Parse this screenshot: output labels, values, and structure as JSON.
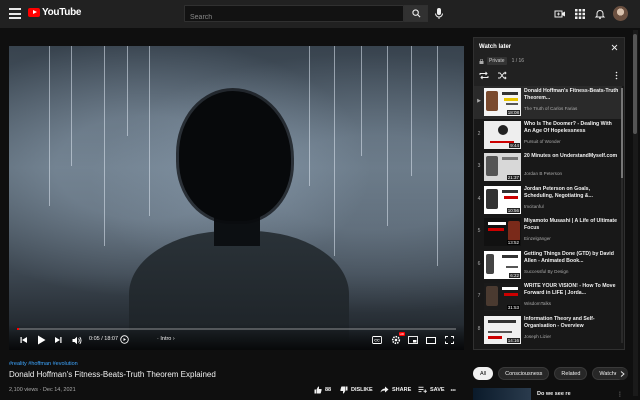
{
  "header": {
    "logo_text": "YouTube",
    "search_placeholder": "Search"
  },
  "player": {
    "time": "0:05 / 18:07",
    "chapter": "· Intro",
    "chapter_arrow": "›",
    "progress_fraction": 0.005,
    "cc_label": "CC",
    "hd_badge": "HD"
  },
  "video": {
    "tags": "#reality #hoffman #evolution",
    "title": "Donald Hoffman's Fitness-Beats-Truth Theorem Explained",
    "meta": "2,100 views · Dec 14, 2021",
    "likes": "88",
    "dislike_label": "DISLIKE",
    "share_label": "SHARE",
    "save_label": "SAVE"
  },
  "playlist": {
    "title": "Watch later",
    "privacy": "Private",
    "position": "1 / 16",
    "items": [
      {
        "index": "▶",
        "title": "Donald Hoffman's Fitness-Beats-Truth Theorem...",
        "channel": "The Truth of Carlos Farias",
        "duration": "18:08"
      },
      {
        "index": "2",
        "title": "Who Is The Doomer? - Dealing With An Age Of Hopelessness",
        "channel": "Pursuit of Wonder",
        "duration": "9:44"
      },
      {
        "index": "3",
        "title": "20 Minutes on UnderstandMyself.com",
        "channel": "Jordan B Peterson",
        "duration": "21:37"
      },
      {
        "index": "4",
        "title": "Jordan Peterson on Goals, Scheduling, Negotiating &...",
        "channel": "tmcitanful",
        "duration": "10:56"
      },
      {
        "index": "5",
        "title": "Miyamoto Musashi | A Life of Ultimate Focus",
        "channel": "Einzelgänger",
        "duration": "13:52"
      },
      {
        "index": "6",
        "title": "Getting Things Done (GTD) by David Allen - Animated Book...",
        "channel": "Successful By Design",
        "duration": "6:22"
      },
      {
        "index": "7",
        "title": "WRITE YOUR VISION! - How To Move Forward in LIFE | Jorda...",
        "channel": "WisdomTalks",
        "duration": "31:53"
      },
      {
        "index": "8",
        "title": "Information Theory and Self-Organisation - Overview",
        "channel": "Joseph Lizier",
        "duration": "14:16"
      }
    ]
  },
  "chips": [
    "All",
    "Consciousness",
    "Related",
    "Watched"
  ],
  "recommended": {
    "title": "Do we see re"
  },
  "colors": {
    "accent": "#ff0000",
    "link": "#3ea6ff",
    "background": "#0f0f0f"
  }
}
